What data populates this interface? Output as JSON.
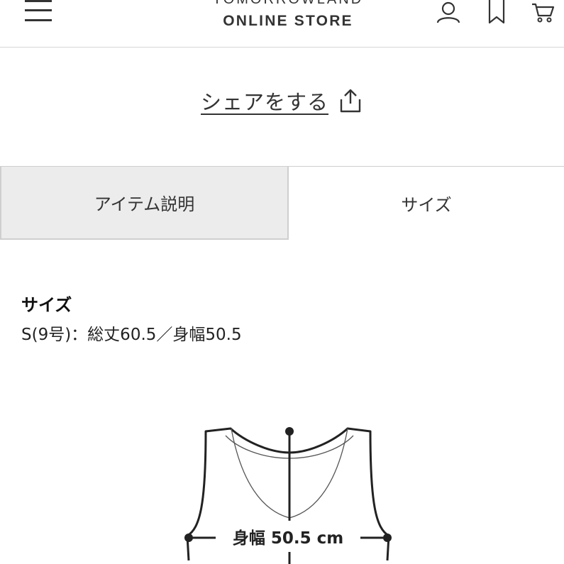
{
  "header": {
    "brand_top": "TOMORROWLAND",
    "brand_bottom": "ONLINE STORE",
    "icons": [
      "menu-icon",
      "user-icon",
      "bookmark-icon",
      "cart-icon"
    ]
  },
  "share": {
    "label": "シェアをする",
    "icon": "share-icon"
  },
  "tabs": [
    {
      "label": "アイテム説明",
      "active": false
    },
    {
      "label": "サイズ",
      "active": true
    }
  ],
  "size_section": {
    "heading": "サイズ",
    "text": "S(9号)：総丈60.5／身幅50.5"
  },
  "diagram": {
    "measure_label": "身幅 50.5 cm"
  },
  "colors": {
    "text": "#222222",
    "inactive_tab_bg": "#ececec",
    "border": "#cfcfcf"
  }
}
